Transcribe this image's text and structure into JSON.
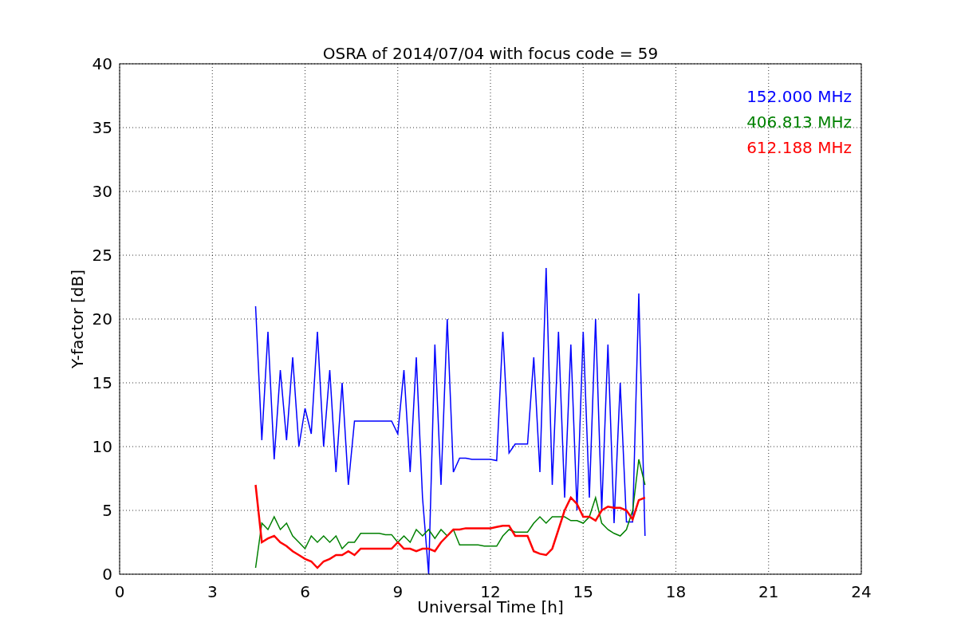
{
  "figure": {
    "chart_data": {
      "type": "line",
      "title": "OSRA of 2014/07/04 with focus code = 59",
      "xlabel": "Universal Time [h]",
      "ylabel": "Y-factor [dB]",
      "xlim": [
        0,
        24
      ],
      "ylim": [
        0,
        40
      ],
      "xticks": [
        0,
        3,
        6,
        9,
        12,
        15,
        18,
        21,
        24
      ],
      "yticks": [
        0,
        5,
        10,
        15,
        20,
        25,
        30,
        35,
        40
      ],
      "grid": true,
      "x": [
        4.4,
        4.6,
        4.8,
        5.0,
        5.2,
        5.4,
        5.6,
        5.8,
        6.0,
        6.2,
        6.4,
        6.6,
        6.8,
        7.0,
        7.2,
        7.4,
        7.6,
        7.8,
        8.0,
        8.2,
        8.4,
        8.6,
        8.8,
        9.0,
        9.2,
        9.4,
        9.6,
        9.8,
        10.0,
        10.2,
        10.4,
        10.6,
        10.8,
        11.0,
        11.2,
        11.4,
        11.6,
        11.8,
        12.0,
        12.2,
        12.4,
        12.6,
        12.8,
        13.0,
        13.2,
        13.4,
        13.6,
        13.8,
        14.0,
        14.2,
        14.4,
        14.6,
        14.8,
        15.0,
        15.2,
        15.4,
        15.6,
        15.8,
        16.0,
        16.2,
        16.4,
        16.6,
        16.8,
        17.0
      ],
      "series": [
        {
          "name": "152.000 MHz",
          "color": "#0000ff",
          "values": [
            21,
            10.5,
            19,
            9,
            16,
            10.5,
            17,
            10,
            13,
            11,
            19,
            10,
            16,
            8,
            15,
            7,
            12,
            12,
            12,
            12,
            12,
            12,
            12,
            11,
            16,
            8,
            17,
            6,
            0,
            18,
            7,
            20,
            8,
            9.1,
            9.1,
            9,
            9,
            9,
            9,
            8.9,
            19,
            9.5,
            10.2,
            10.2,
            10.2,
            17,
            8,
            24,
            7,
            19,
            6,
            18,
            5,
            19,
            6,
            20,
            5,
            18,
            4,
            15,
            4.1,
            4.1,
            22,
            3
          ]
        },
        {
          "name": "406.813 MHz",
          "color": "#008000",
          "values": [
            0.5,
            4,
            3.5,
            4.5,
            3.5,
            4,
            3,
            2.5,
            2,
            3,
            2.5,
            3,
            2.5,
            3,
            2,
            2.5,
            2.5,
            3.2,
            3.2,
            3.2,
            3.2,
            3.1,
            3.1,
            2.5,
            3,
            2.5,
            3.5,
            3,
            3.5,
            2.8,
            3.5,
            3,
            3.5,
            2.3,
            2.3,
            2.3,
            2.3,
            2.2,
            2.2,
            2.2,
            3,
            3.5,
            3.3,
            3.3,
            3.3,
            4,
            4.5,
            4,
            4.5,
            4.5,
            4.5,
            4.2,
            4.2,
            4,
            4.5,
            6,
            4,
            3.5,
            3.2,
            3,
            3.5,
            5,
            9,
            7
          ]
        },
        {
          "name": "612.188 MHz",
          "color": "#ff0000",
          "values": [
            7,
            2.5,
            2.8,
            3,
            2.5,
            2.2,
            1.8,
            1.5,
            1.2,
            1,
            0.5,
            1,
            1.2,
            1.5,
            1.5,
            1.8,
            1.5,
            2,
            2,
            2,
            2,
            2,
            2,
            2.5,
            2,
            2,
            1.8,
            2,
            2,
            1.8,
            2.5,
            3,
            3.5,
            3.5,
            3.6,
            3.6,
            3.6,
            3.6,
            3.6,
            3.7,
            3.8,
            3.8,
            3,
            3,
            3,
            1.8,
            1.6,
            1.5,
            2,
            3.5,
            5,
            6,
            5.5,
            4.5,
            4.5,
            4.2,
            5,
            5.3,
            5.2,
            5.2,
            5,
            4.3,
            5.8,
            6
          ]
        }
      ]
    }
  }
}
